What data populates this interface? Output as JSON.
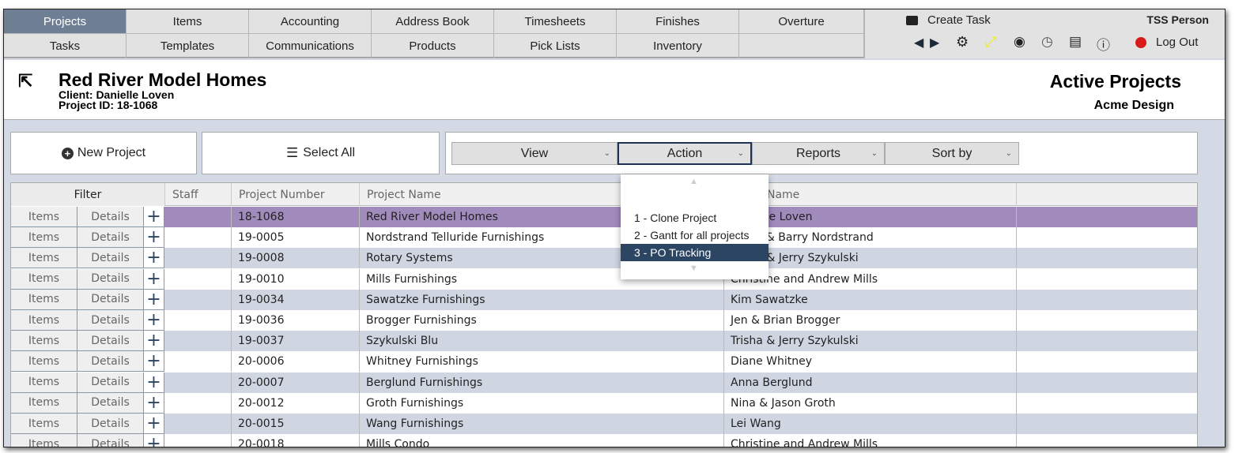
{
  "nav": {
    "tabs_row1": [
      "Projects",
      "Items",
      "Accounting",
      "Address Book",
      "Timesheets",
      "Finishes",
      "Overture"
    ],
    "tabs_row2": [
      "Tasks",
      "Templates",
      "Communications",
      "Products",
      "Pick Lists",
      "Inventory",
      ""
    ],
    "active": "Projects",
    "create_task": "Create Task",
    "user": "TSS Person",
    "logout": "Log Out",
    "icons": [
      "chat-bubble-icon",
      "arrow-left-icon",
      "arrow-right-icon",
      "gear-icon",
      "resize-icon",
      "user-icon",
      "clock-icon",
      "newspaper-icon",
      "info-icon",
      "logout-icon"
    ]
  },
  "header": {
    "title": "Red River Model Homes",
    "client": "Client: Danielle Loven",
    "project_id": "Project ID: 18-1068",
    "section": "Active Projects",
    "company": "Acme Design"
  },
  "toolbar": {
    "new_project": "New Project",
    "select_all": "Select All",
    "view": "View",
    "action": "Action",
    "reports": "Reports",
    "sort_by": "Sort by"
  },
  "action_menu": {
    "items": [
      "1 - Clone Project",
      "2 - Gantt for all projects",
      "3 - PO Tracking"
    ],
    "selected": "3 - PO Tracking"
  },
  "table": {
    "filter": "Filter",
    "items_label": "Items",
    "details_label": "Details",
    "columns": [
      "Staff",
      "Project Number",
      "Project Name",
      "Client Name"
    ],
    "rows": [
      [
        "",
        "18-1068",
        "Red River Model Homes",
        "Danielle Loven"
      ],
      [
        "",
        "19-0005",
        "Nordstrand Telluride Furnishings",
        "Karen & Barry Nordstrand"
      ],
      [
        "",
        "19-0008",
        "Rotary Systems",
        "Trisha & Jerry Szykulski"
      ],
      [
        "",
        "19-0010",
        "Mills Furnishings",
        "Christine and Andrew Mills"
      ],
      [
        "",
        "19-0034",
        "Sawatzke Furnishings",
        "Kim Sawatzke"
      ],
      [
        "",
        "19-0036",
        "Brogger Furnishings",
        "Jen & Brian Brogger"
      ],
      [
        "",
        "19-0037",
        "Szykulski Blu",
        "Trisha & Jerry Szykulski"
      ],
      [
        "",
        "20-0006",
        "Whitney Furnishings",
        "Diane Whitney"
      ],
      [
        "",
        "20-0007",
        "Berglund Furnishings",
        "Anna Berglund"
      ],
      [
        "",
        "20-0012",
        "Groth Furnishings",
        "Nina & Jason Groth"
      ],
      [
        "",
        "20-0015",
        "Wang Furnishings",
        "Lei Wang"
      ],
      [
        "",
        "20-0018",
        "Mills Condo",
        "Christine and Andrew Mills"
      ]
    ],
    "selected_row": 0
  },
  "colors": {
    "active_tab": "#6f7f93",
    "selected_row": "#a18bbd",
    "alt_row": "#cfd5e1",
    "menu_selected": "#2c4563",
    "background": "#d3dae5"
  }
}
